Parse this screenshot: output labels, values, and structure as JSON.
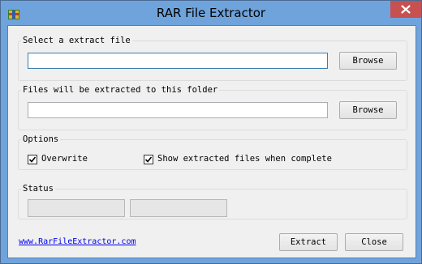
{
  "window": {
    "title": "RAR File Extractor"
  },
  "source": {
    "legend": "Select a extract file",
    "value": "",
    "browse_label": "Browse"
  },
  "destination": {
    "legend": "Files will be extracted to this folder",
    "value": "",
    "browse_label": "Browse"
  },
  "options": {
    "legend": "Options",
    "overwrite": {
      "label": "Overwrite",
      "checked": true
    },
    "show_files": {
      "label": "Show extracted files when complete",
      "checked": true
    }
  },
  "status": {
    "legend": "Status"
  },
  "footer": {
    "link": "www.RarFileExtractor.com",
    "extract_label": "Extract",
    "close_label": "Close"
  },
  "colors": {
    "title_bar": "#6fa3dc",
    "close_button": "#c75050",
    "dialog_bg": "#f0f0f0",
    "link": "#0000ee"
  }
}
